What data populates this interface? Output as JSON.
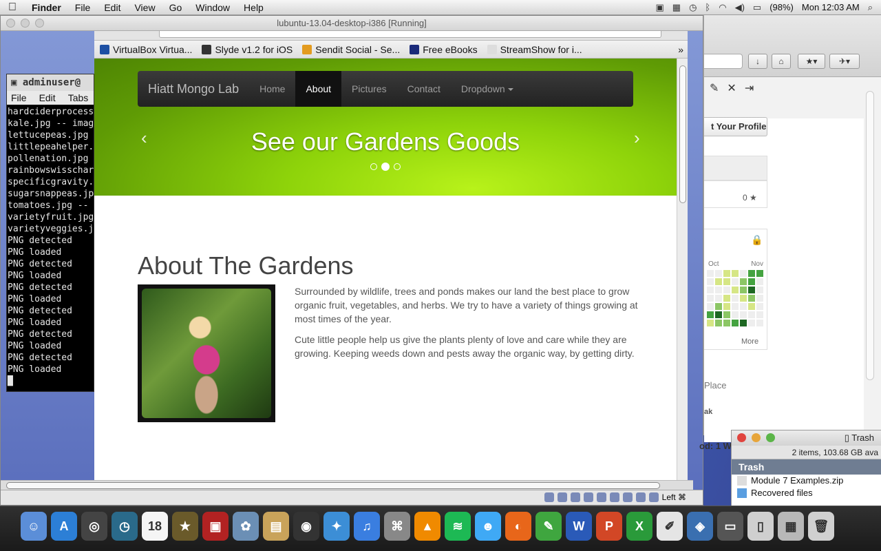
{
  "menubar": {
    "apple": "",
    "items": [
      {
        "label": "Finder",
        "bold": true
      },
      {
        "label": "File"
      },
      {
        "label": "Edit"
      },
      {
        "label": "View"
      },
      {
        "label": "Go"
      },
      {
        "label": "Window"
      },
      {
        "label": "Help"
      }
    ],
    "battery": "(98%)",
    "clock": "Mon 12:03 AM"
  },
  "vbox": {
    "title": "lubuntu-13.04-desktop-i386 [Running]",
    "host_key": "Left ⌘"
  },
  "terminal": {
    "title": "adminuser@",
    "menu": [
      "File",
      "Edit",
      "Tabs"
    ],
    "lines": [
      "hardciderprocess",
      "kale.jpg -- imag",
      "lettucepeas.jpg",
      "littlepeahelper.",
      "pollenation.jpg",
      "rainbowswisschar",
      "specificgravity.",
      "sugarsnappeas.jp",
      "tomatoes.jpg --",
      "varietyfruit.jpg",
      "varietyveggies.j",
      "PNG detected",
      "PNG loaded",
      "PNG detected",
      "PNG loaded",
      "PNG detected",
      "PNG loaded",
      "PNG detected",
      "PNG loaded",
      "PNG detected",
      "PNG loaded",
      "PNG detected",
      "PNG loaded"
    ]
  },
  "browser": {
    "bookmarks": [
      {
        "label": "VirtualBox Virtua...",
        "color": "#1d4fa3"
      },
      {
        "label": "Slyde v1.2 for iOS",
        "color": "#333333"
      },
      {
        "label": "Sendit Social - Se...",
        "color": "#e39b1f"
      },
      {
        "label": "Free eBooks",
        "color": "#1a2a7a"
      },
      {
        "label": "StreamShow for i...",
        "color": "#dddddd"
      }
    ],
    "overflow": "»"
  },
  "site": {
    "brand": "Hiatt Mongo Lab",
    "nav": [
      "Home",
      "About",
      "Pictures",
      "Contact",
      "Dropdown"
    ],
    "active_nav": "About",
    "carousel": {
      "heading": "See our Gardens Goods",
      "prev": "‹",
      "next": "›",
      "active_slide": 2,
      "slide_count": 3
    },
    "about": {
      "heading": "About The Gardens",
      "p1": "Surrounded by wildlife, trees and ponds makes our land the best place to grow organic fruit, vegetables, and herbs. We try to have a variety of things growing at most times of the year.",
      "p2": "Cute little people help us give the plants plenty of love and care while they are growing. Keeping weeds down and pests away the organic way, by getting dirty."
    }
  },
  "rightwin": {
    "profile_button": "t Your Profile",
    "stars": "0 ★",
    "months": [
      "Oct",
      "Nov"
    ],
    "more": "More",
    "place": "Place",
    "peak": "ak",
    "od_label": "od: 1 W"
  },
  "trash": {
    "title": "Trash",
    "status": "2 items, 103.68 GB ava",
    "header": "Trash",
    "items": [
      "Module 7 Examples.zip",
      "Recovered files"
    ]
  },
  "dock": {
    "apps": [
      {
        "name": "finder",
        "color": "#5b8ed8",
        "glyph": "☺"
      },
      {
        "name": "app-store",
        "color": "#2c7fd6",
        "glyph": "A"
      },
      {
        "name": "dashboard",
        "color": "#444444",
        "glyph": "◎"
      },
      {
        "name": "time-machine",
        "color": "#2a6a8a",
        "glyph": "◷"
      },
      {
        "name": "calendar",
        "color": "#f5f5f5",
        "glyph": "18"
      },
      {
        "name": "imovie",
        "color": "#6a5a2a",
        "glyph": "★"
      },
      {
        "name": "photo-booth",
        "color": "#b22222",
        "glyph": "▣"
      },
      {
        "name": "iphoto",
        "color": "#6b8fb5",
        "glyph": "✿"
      },
      {
        "name": "image-capture",
        "color": "#c9a35a",
        "glyph": "▤"
      },
      {
        "name": "facetime",
        "color": "#333333",
        "glyph": "◉"
      },
      {
        "name": "safari",
        "color": "#3c8ed6",
        "glyph": "✦"
      },
      {
        "name": "itunes",
        "color": "#3a7ee0",
        "glyph": "♫"
      },
      {
        "name": "preview",
        "color": "#888888",
        "glyph": "⌘"
      },
      {
        "name": "vlc",
        "color": "#f08a00",
        "glyph": "▲"
      },
      {
        "name": "spotify",
        "color": "#1db954",
        "glyph": "≋"
      },
      {
        "name": "messages",
        "color": "#3fa9f5",
        "glyph": "☻"
      },
      {
        "name": "firefox",
        "color": "#e8661a",
        "glyph": "◐"
      },
      {
        "name": "evernote",
        "color": "#3fa63f",
        "glyph": "✎"
      },
      {
        "name": "word",
        "color": "#2a5ab8",
        "glyph": "W"
      },
      {
        "name": "powerpoint",
        "color": "#d24726",
        "glyph": "P"
      },
      {
        "name": "excel",
        "color": "#2a9a3a",
        "glyph": "X"
      },
      {
        "name": "textedit",
        "color": "#e5e5e5",
        "glyph": "✐"
      },
      {
        "name": "virtualbox",
        "color": "#3a6fb0",
        "glyph": "◈"
      },
      {
        "name": "screen",
        "color": "#555555",
        "glyph": "▭"
      },
      {
        "name": "documents",
        "color": "#cfcfcf",
        "glyph": "▯"
      },
      {
        "name": "downloads",
        "color": "#b8b8b8",
        "glyph": "▦"
      },
      {
        "name": "trash",
        "color": "#d0d0d0",
        "glyph": "🗑"
      }
    ]
  }
}
